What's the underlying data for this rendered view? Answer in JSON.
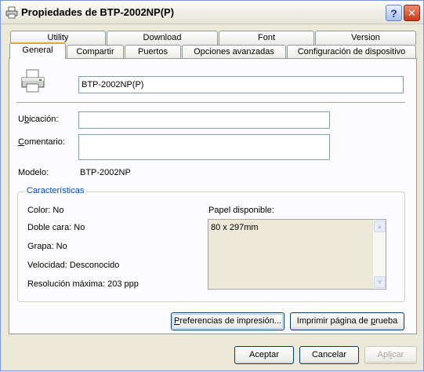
{
  "window": {
    "title": "Propiedades de BTP-2002NP(P)",
    "help_label": "?",
    "close_label": "✕"
  },
  "tabs_row1": [
    "Utility",
    "Download",
    "Font",
    "Version"
  ],
  "tabs_row2": [
    "General",
    "Compartir",
    "Puertos",
    "Opciones avanzadas",
    "Configuración de dispositivo"
  ],
  "general": {
    "printer_name": "BTP-2002NP(P)",
    "location_label_pre": "U",
    "location_label_acc": "b",
    "location_label_post": "icación:",
    "location_value": "",
    "comment_label_pre": "",
    "comment_label_acc": "C",
    "comment_label_post": "omentario:",
    "comment_value": "",
    "model_label": "Modelo:",
    "model_value": "BTP-2002NP"
  },
  "features": {
    "title": "Características",
    "color": "Color: No",
    "duplex": "Doble cara: No",
    "staple": "Grapa: No",
    "speed": "Velocidad: Desconocido",
    "resolution": "Resolución máxima: 203 ppp",
    "paper_label": "Papel disponible:",
    "paper_items": [
      "80 x 297mm"
    ]
  },
  "buttons": {
    "prefs_pre": "",
    "prefs_acc": "P",
    "prefs_post": "referencias de impresión...",
    "test_pre": "Imprimir página de ",
    "test_acc": "p",
    "test_post": "rueba",
    "ok": "Aceptar",
    "cancel": "Cancelar",
    "apply_pre": "Apl",
    "apply_acc": "i",
    "apply_post": "car"
  }
}
